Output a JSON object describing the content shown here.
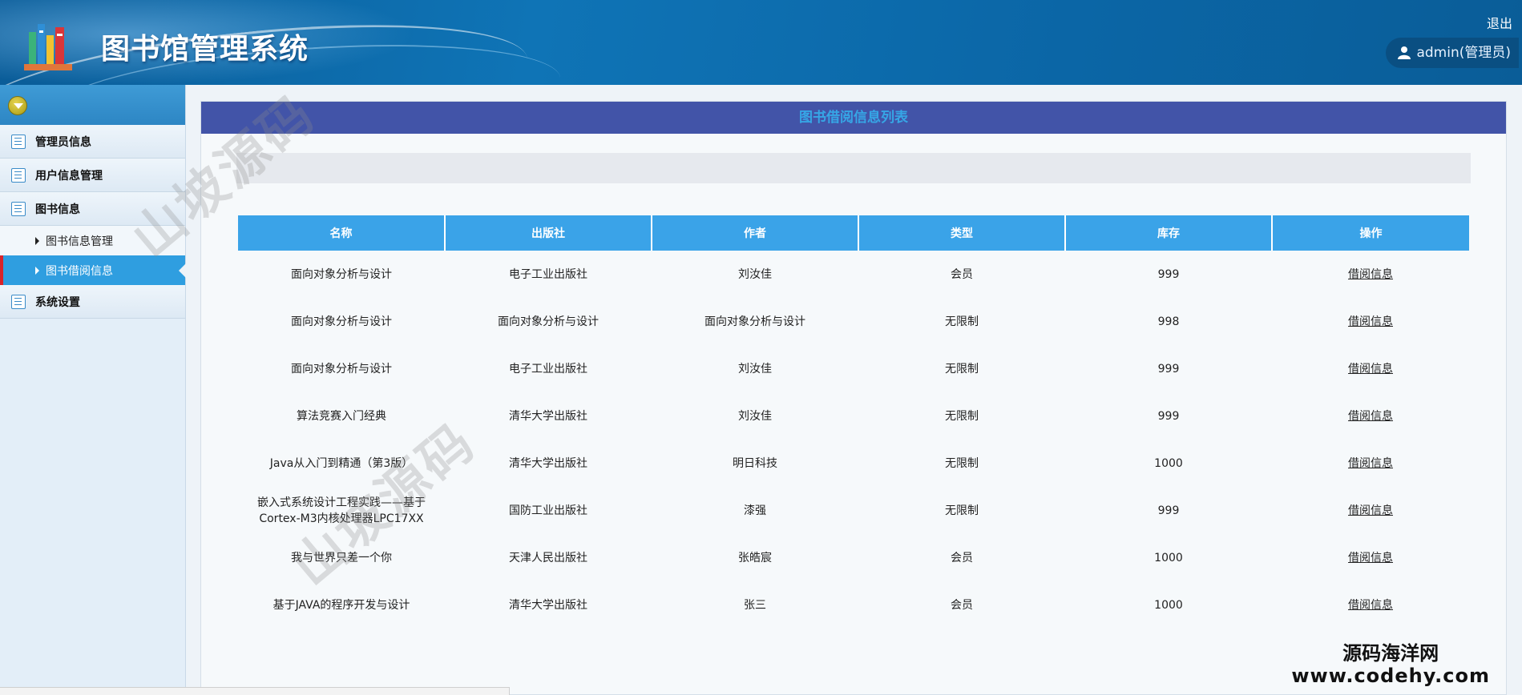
{
  "header": {
    "title": "图书馆管理系统",
    "logout": "退出",
    "user": "admin(管理员)"
  },
  "sidebar": {
    "groups": [
      {
        "label": "管理员信息"
      },
      {
        "label": "用户信息管理"
      },
      {
        "label": "图书信息",
        "children": [
          "图书信息管理",
          "图书借阅信息"
        ],
        "active_child": 1
      },
      {
        "label": "系统设置"
      }
    ]
  },
  "panel": {
    "title": "图书借阅信息列表"
  },
  "table": {
    "headers": [
      "名称",
      "出版社",
      "作者",
      "类型",
      "库存",
      "操作"
    ],
    "rows": [
      [
        "面向对象分析与设计",
        "电子工业出版社",
        "刘汝佳",
        "会员",
        "999",
        "借阅信息"
      ],
      [
        "面向对象分析与设计",
        "面向对象分析与设计",
        "面向对象分析与设计",
        "无限制",
        "998",
        "借阅信息"
      ],
      [
        "面向对象分析与设计",
        "电子工业出版社",
        "刘汝佳",
        "无限制",
        "999",
        "借阅信息"
      ],
      [
        "算法竞赛入门经典",
        "清华大学出版社",
        "刘汝佳",
        "无限制",
        "999",
        "借阅信息"
      ],
      [
        "Java从入门到精通（第3版）",
        "清华大学出版社",
        "明日科技",
        "无限制",
        "1000",
        "借阅信息"
      ],
      [
        "嵌入式系统设计工程实践——基于Cortex-M3内核处理器LPC17XX",
        "国防工业出版社",
        "漆强",
        "无限制",
        "999",
        "借阅信息"
      ],
      [
        "我与世界只差一个你",
        "天津人民出版社",
        "张皓宸",
        "会员",
        "1000",
        "借阅信息"
      ],
      [
        "基于JAVA的程序开发与设计",
        "清华大学出版社",
        "张三",
        "会员",
        "1000",
        "借阅信息"
      ]
    ]
  },
  "watermarks": {
    "diagonal": "山坡源码",
    "corner_name": "源码海洋网",
    "corner_url": "www.codehy.com"
  },
  "colors": {
    "header": "#0f74b6",
    "panel_title_bg": "#4254a8",
    "panel_title_text": "#36a6e6",
    "table_header": "#3aa3e8",
    "active_menu": "#2f9ee0"
  }
}
